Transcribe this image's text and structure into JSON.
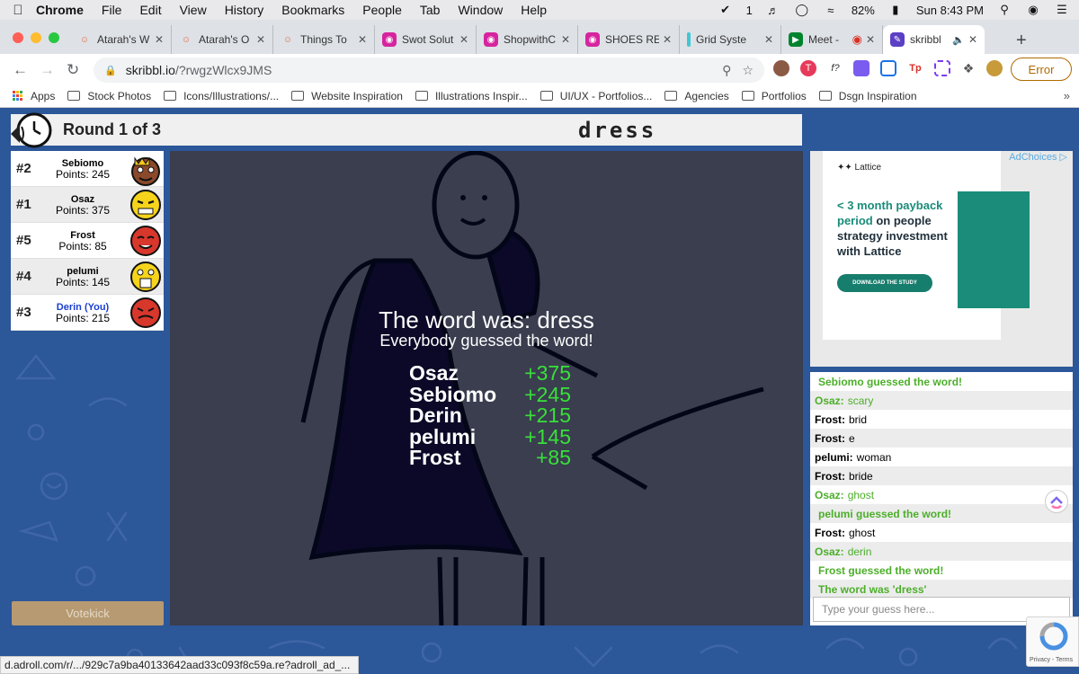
{
  "menubar": {
    "app": "Chrome",
    "items": [
      "File",
      "Edit",
      "View",
      "History",
      "Bookmarks",
      "People",
      "Tab",
      "Window",
      "Help"
    ],
    "notif_count": "1",
    "battery": "82%",
    "clock": "Sun 8:43 PM"
  },
  "tabs": [
    {
      "label": "Atarah's W",
      "favicon": "smile-icon"
    },
    {
      "label": "Atarah's O",
      "favicon": "smile-icon"
    },
    {
      "label": "Things To",
      "favicon": "smile-icon"
    },
    {
      "label": "Swot Solut",
      "favicon": "instagram-icon"
    },
    {
      "label": "ShopwithC",
      "favicon": "instagram-icon"
    },
    {
      "label": "SHOES RE",
      "favicon": "instagram-icon"
    },
    {
      "label": "Grid Syste",
      "favicon": "grid-icon"
    },
    {
      "label": "Meet -",
      "favicon": "meet-icon"
    },
    {
      "label": "skribbl",
      "favicon": "skribbl-icon"
    }
  ],
  "address": {
    "host": "skribbl.io",
    "path": "/?rwgzWlcx9JMS"
  },
  "error_label": "Error",
  "bookmarks": [
    "Apps",
    "Stock Photos",
    "Icons/Illustrations/...",
    "Website Inspiration",
    "Illustrations Inspir...",
    "UI/UX - Portfolios...",
    "Agencies",
    "Portfolios",
    "Dsgn Inspiration"
  ],
  "game": {
    "round": "Round 1 of 3",
    "word": "dress",
    "players": [
      {
        "rank": "#2",
        "name": "Sebiomo",
        "points": "Points: 245",
        "you": false
      },
      {
        "rank": "#1",
        "name": "Osaz",
        "points": "Points: 375",
        "you": false
      },
      {
        "rank": "#5",
        "name": "Frost",
        "points": "Points: 85",
        "you": false
      },
      {
        "rank": "#4",
        "name": "pelumi",
        "points": "Points: 145",
        "you": false
      },
      {
        "rank": "#3",
        "name": "Derin (You)",
        "points": "Points: 215",
        "you": true
      }
    ],
    "votekick": "Votekick",
    "overlay": {
      "title": "The word was: dress",
      "subtitle": "Everybody guessed the word!",
      "results": [
        {
          "name": "Osaz",
          "score": "+375"
        },
        {
          "name": "Sebiomo",
          "score": "+245"
        },
        {
          "name": "Derin",
          "score": "+215"
        },
        {
          "name": "pelumi",
          "score": "+145"
        },
        {
          "name": "Frost",
          "score": "+85"
        }
      ]
    },
    "chat": [
      {
        "who": "",
        "text": "Sebiomo guessed the word!",
        "type": "announce"
      },
      {
        "who": "Osaz:",
        "text": "scary",
        "type": "green"
      },
      {
        "who": "Frost:",
        "text": "brid",
        "type": "normal"
      },
      {
        "who": "Frost:",
        "text": "e",
        "type": "normal"
      },
      {
        "who": "pelumi:",
        "text": "woman",
        "type": "normal"
      },
      {
        "who": "Frost:",
        "text": "bride",
        "type": "normal"
      },
      {
        "who": "Osaz:",
        "text": "ghost",
        "type": "green"
      },
      {
        "who": "",
        "text": "pelumi guessed the word!",
        "type": "announce"
      },
      {
        "who": "Frost:",
        "text": "ghost",
        "type": "normal"
      },
      {
        "who": "Osaz:",
        "text": "derin",
        "type": "green"
      },
      {
        "who": "",
        "text": "Frost guessed the word!",
        "type": "announce"
      },
      {
        "who": "",
        "text": "The word was 'dress'",
        "type": "announce"
      }
    ],
    "chat_placeholder": "Type your guess here..."
  },
  "ad": {
    "adchoices": "AdChoices",
    "brand": "Lattice",
    "headline_accent": "< 3 month payback period",
    "headline_rest": " on people strategy investment with Lattice",
    "cta": "DOWNLOAD THE STUDY"
  },
  "recaptcha_links": "Privacy - Terms",
  "status_url": "d.adroll.com/r/.../929c7a9ba40133642aad33c093f8c59a.re?adroll_ad_...",
  "colors": {
    "accent_green": "#39e039",
    "chat_green": "#4caf2a",
    "game_bg": "#2c5799",
    "dress_purple": "#2b0e48"
  }
}
